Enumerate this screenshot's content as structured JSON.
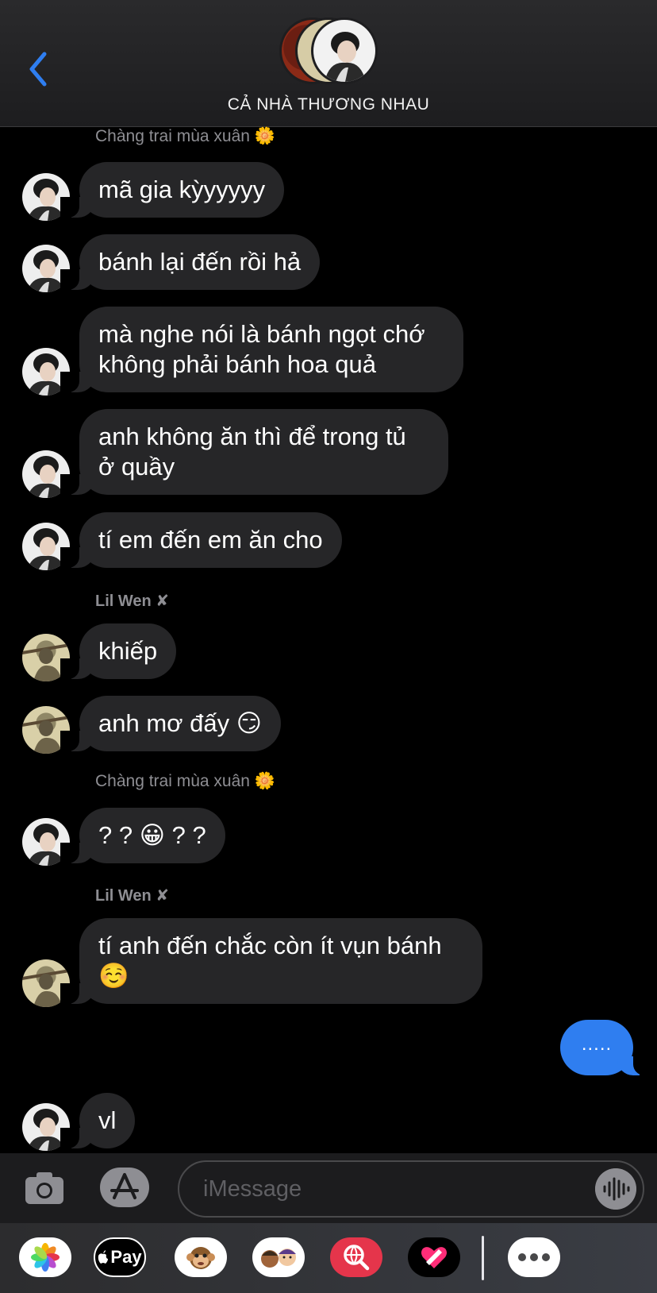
{
  "header": {
    "title": "CẢ NHÀ THƯƠNG NHAU"
  },
  "groups": [
    {
      "sender": "Chàng trai mùa xuân 🌼",
      "messages": [
        {
          "lines": [
            "mã gia kỳyyyyy"
          ]
        },
        {
          "lines": [
            "bánh lại đến rồi hả"
          ]
        },
        {
          "lines": [
            "mà nghe nói là bánh ngọt chớ",
            "không phải bánh hoa quả"
          ]
        },
        {
          "lines": [
            "anh không ăn thì để trong tủ",
            "ở quầy"
          ]
        },
        {
          "lines": [
            "tí em đến em ăn cho"
          ]
        }
      ]
    },
    {
      "sender": "Lil Wen ✘",
      "messages": [
        {
          "lines": [
            "khiếp"
          ]
        },
        {
          "lines": [
            "anh mơ đấy 😏"
          ]
        }
      ]
    },
    {
      "sender": "Chàng trai mùa xuân 🌼",
      "messages": [
        {
          "lines": [
            "? ? 😀 ? ?"
          ]
        }
      ]
    },
    {
      "sender": "Lil Wen ✘",
      "messages": [
        {
          "lines": [
            "tí anh đến chắc còn ít vụn bánh",
            "☺️"
          ]
        }
      ]
    }
  ],
  "outgoing": {
    "text": "....."
  },
  "last_message": {
    "text": "vl"
  },
  "input": {
    "placeholder": "iMessage"
  },
  "icons": {
    "back": "chevron-left-icon",
    "camera": "camera-icon",
    "app_store": "app-store-icon",
    "voice": "waveform-icon"
  },
  "drawer_apps": [
    {
      "name": "photos-app-icon"
    },
    {
      "name": "apple-pay-app-icon",
      "label": "Pay"
    },
    {
      "name": "animoji-app-icon"
    },
    {
      "name": "memoji-app-icon"
    },
    {
      "name": "web-search-app-icon"
    },
    {
      "name": "digital-touch-app-icon"
    },
    {
      "name": "more-apps-icon"
    }
  ],
  "colors": {
    "accent": "#2f7ef0",
    "incoming_bubble": "#262628",
    "background": "#000000"
  }
}
